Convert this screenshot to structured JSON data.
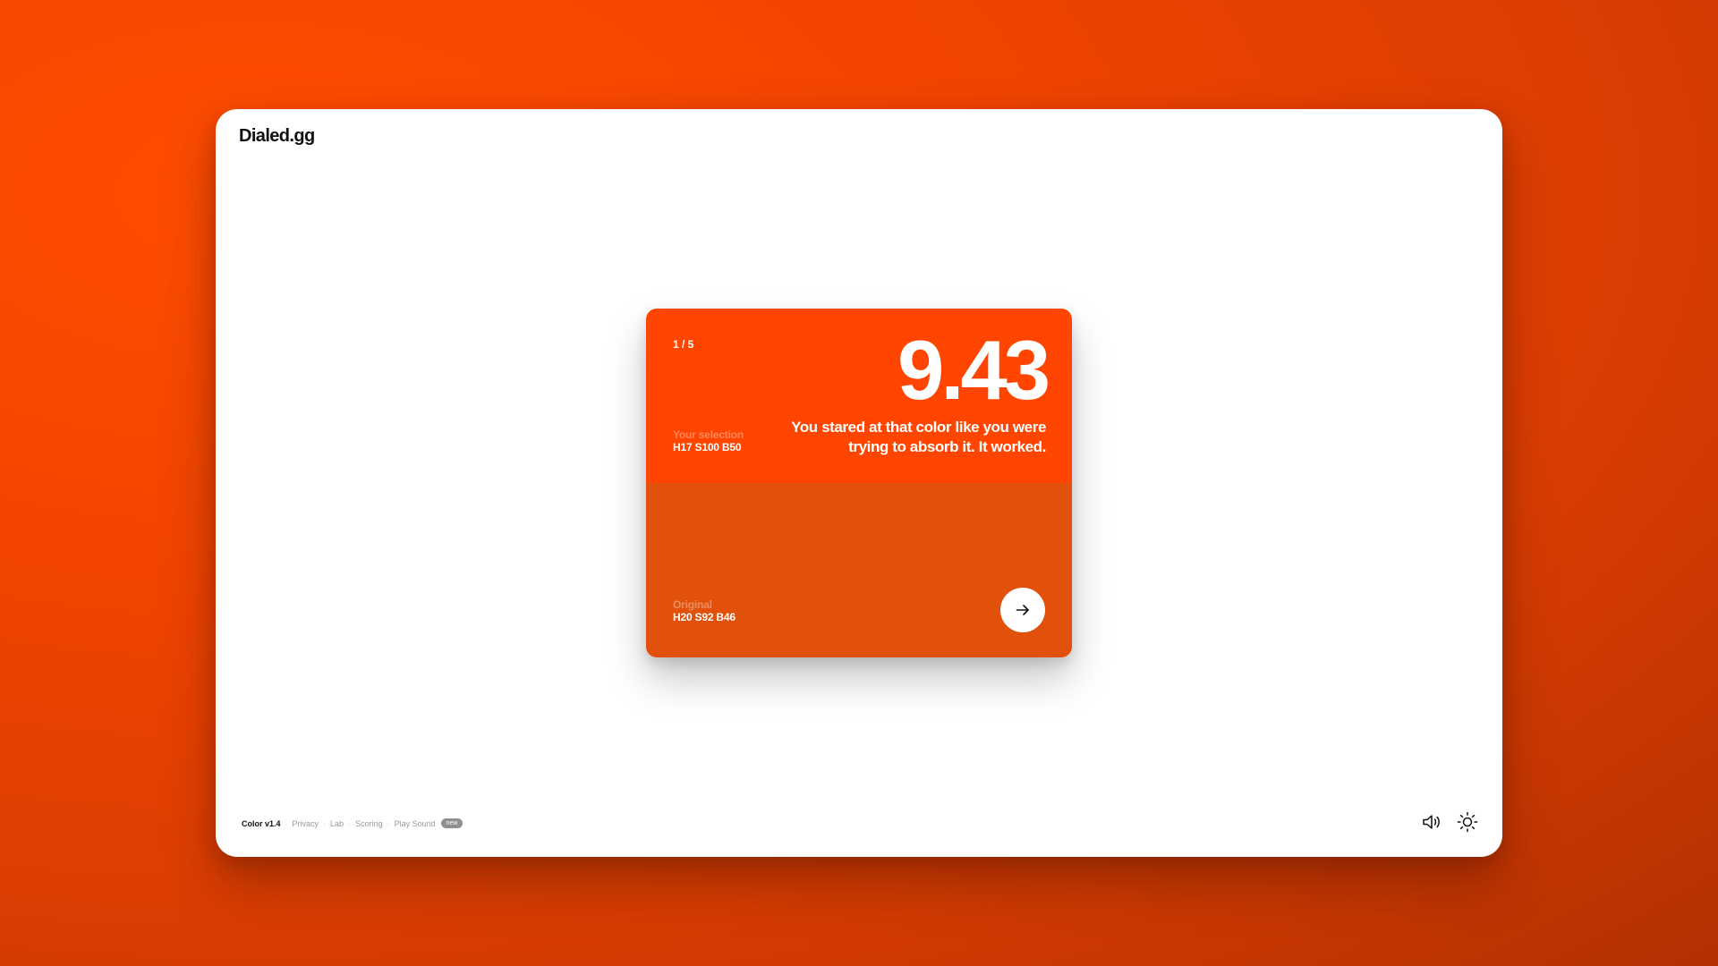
{
  "app": {
    "logo": "Dialed.gg"
  },
  "result_card": {
    "round": "1 / 5",
    "score": "9.43",
    "message": "You stared at that color like you were trying to absorb it. It worked.",
    "selection": {
      "label": "Your selection",
      "value": "H17 S100 B50",
      "color": "#ff4500"
    },
    "original": {
      "label": "Original",
      "value": "H20 S92 B46",
      "color": "#e1510b"
    },
    "next_icon": "arrow-right-icon"
  },
  "footer": {
    "app_version": "Color v1.4",
    "links": [
      "Privacy",
      "Lab",
      "Scoring",
      "Play Sound"
    ],
    "badge": "new",
    "separator": "·"
  },
  "controls": {
    "sound_icon": "speaker-icon",
    "theme_icon": "sun-icon"
  },
  "colors": {
    "background_accent": "#ff4500",
    "window": "#ffffff",
    "text": "#111111"
  }
}
